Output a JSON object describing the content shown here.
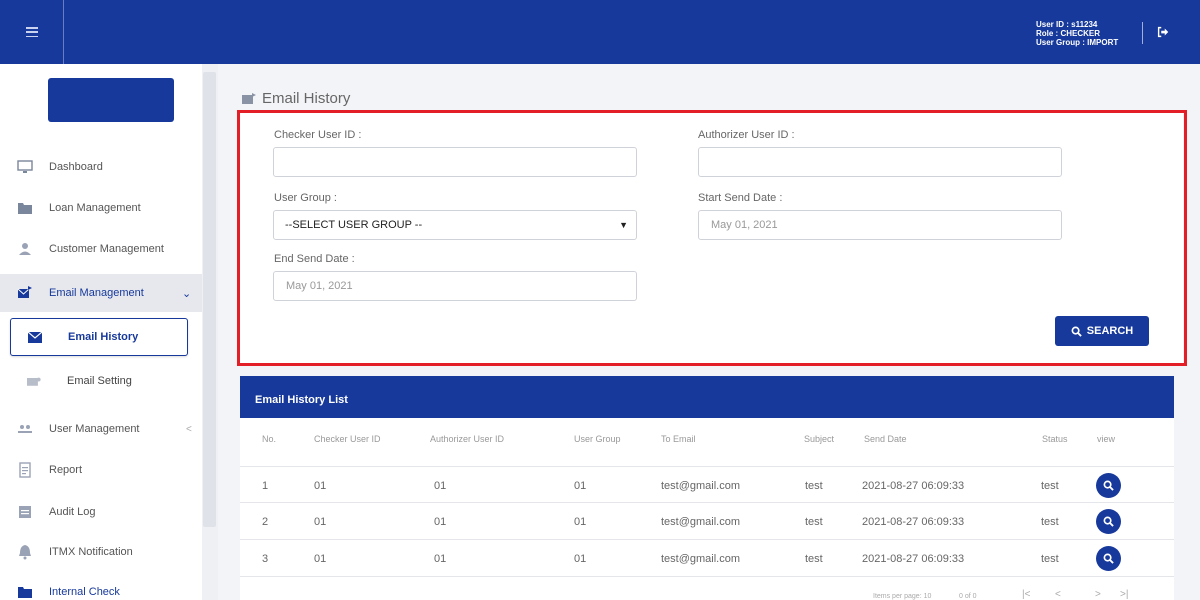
{
  "header": {
    "user_id": "User ID : s11234",
    "role": "Role : CHECKER",
    "user_group": "User Group : IMPORT"
  },
  "sidebar": {
    "items": [
      {
        "label": "Dashboard",
        "icon": "monitor-icon"
      },
      {
        "label": "Loan Management",
        "icon": "folder-icon"
      },
      {
        "label": "Customer Management",
        "icon": "user-icon"
      },
      {
        "label": "Email Management",
        "icon": "email-send-icon",
        "active": true
      },
      {
        "label": "User Management",
        "icon": "users-icon"
      },
      {
        "label": "Report",
        "icon": "report-icon"
      },
      {
        "label": "Audit Log",
        "icon": "audit-log-icon"
      },
      {
        "label": "ITMX Notification",
        "icon": "bell-icon"
      },
      {
        "label": "Internal Check",
        "icon": "folder-icon"
      }
    ],
    "subitems": [
      {
        "label": "Email History",
        "icon": "envelope-icon",
        "selected": true
      },
      {
        "label": "Email Setting",
        "icon": "envelope-setting-icon"
      }
    ]
  },
  "page": {
    "title": "Email History"
  },
  "form": {
    "checker_label": "Checker User ID :",
    "authorizer_label": "Authorizer User ID :",
    "user_group_label": "User Group :",
    "user_group_value": "--SELECT USER GROUP --",
    "start_label": "Start Send Date :",
    "start_placeholder": "May 01, 2021",
    "end_label": "End Send Date :",
    "end_placeholder": "May 01, 2021",
    "search_label": "SEARCH"
  },
  "table": {
    "title": "Email History List",
    "columns": [
      "No.",
      "Checker User ID",
      "Authorizer User ID",
      "User Group",
      "To Email",
      "Subject",
      "Send Date",
      "Status",
      "view"
    ],
    "rows": [
      {
        "no": "1",
        "checker": "01",
        "authorizer": "01",
        "group": "01",
        "email": "test@gmail.com",
        "subject": "test",
        "date": "2021-08-27 06:09:33",
        "status": "test"
      },
      {
        "no": "2",
        "checker": "01",
        "authorizer": "01",
        "group": "01",
        "email": "test@gmail.com",
        "subject": "test",
        "date": "2021-08-27 06:09:33",
        "status": "test"
      },
      {
        "no": "3",
        "checker": "01",
        "authorizer": "01",
        "group": "01",
        "email": "test@gmail.com",
        "subject": "test",
        "date": "2021-08-27 06:09:33",
        "status": "test"
      }
    ],
    "pager": {
      "items_per_page": "Items per page: 10",
      "range": "0 of 0"
    }
  },
  "colors": {
    "primary": "#17399b",
    "highlight": "#e41e26"
  }
}
